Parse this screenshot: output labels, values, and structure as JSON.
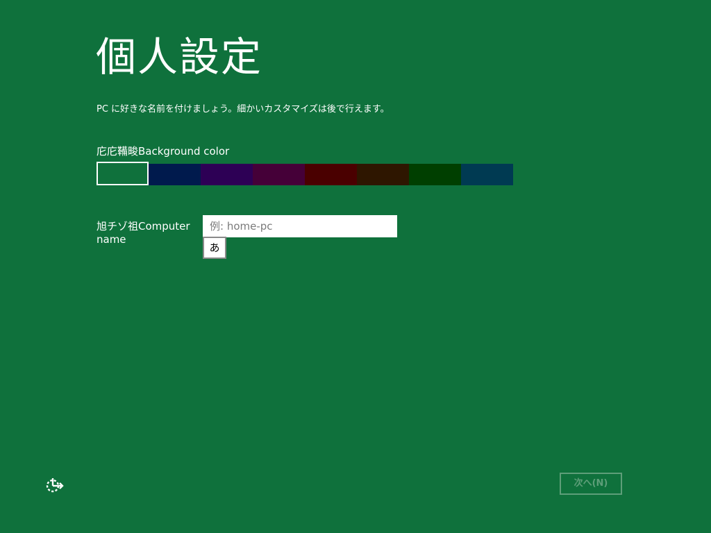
{
  "page": {
    "title": "個人設定",
    "instruction": "PC に好きな名前を付けましょう。細かいカスタマイズは後で行えます。"
  },
  "background": {
    "label": "庀庀鞴畯Background color",
    "swatches": [
      {
        "color": "#0f713c",
        "selected": true
      },
      {
        "color": "#001a4d",
        "selected": false
      },
      {
        "color": "#2d0055",
        "selected": false
      },
      {
        "color": "#450038",
        "selected": false
      },
      {
        "color": "#4a0000",
        "selected": false
      },
      {
        "color": "#2e1600",
        "selected": false
      },
      {
        "color": "#003f00",
        "selected": false
      },
      {
        "color": "#003a52",
        "selected": false
      }
    ]
  },
  "computer_name": {
    "label": "旭チゾ祖Computer name",
    "placeholder": "例: home-pc",
    "value": "",
    "ime_indicator": "あ"
  },
  "footer": {
    "ease_of_access_icon": "ease-of-access-icon",
    "next_label": "次へ(N)",
    "next_enabled": false
  },
  "colors": {
    "background": "#0f713c",
    "text": "#ffffff",
    "disabled_button": "#5e9e79"
  }
}
